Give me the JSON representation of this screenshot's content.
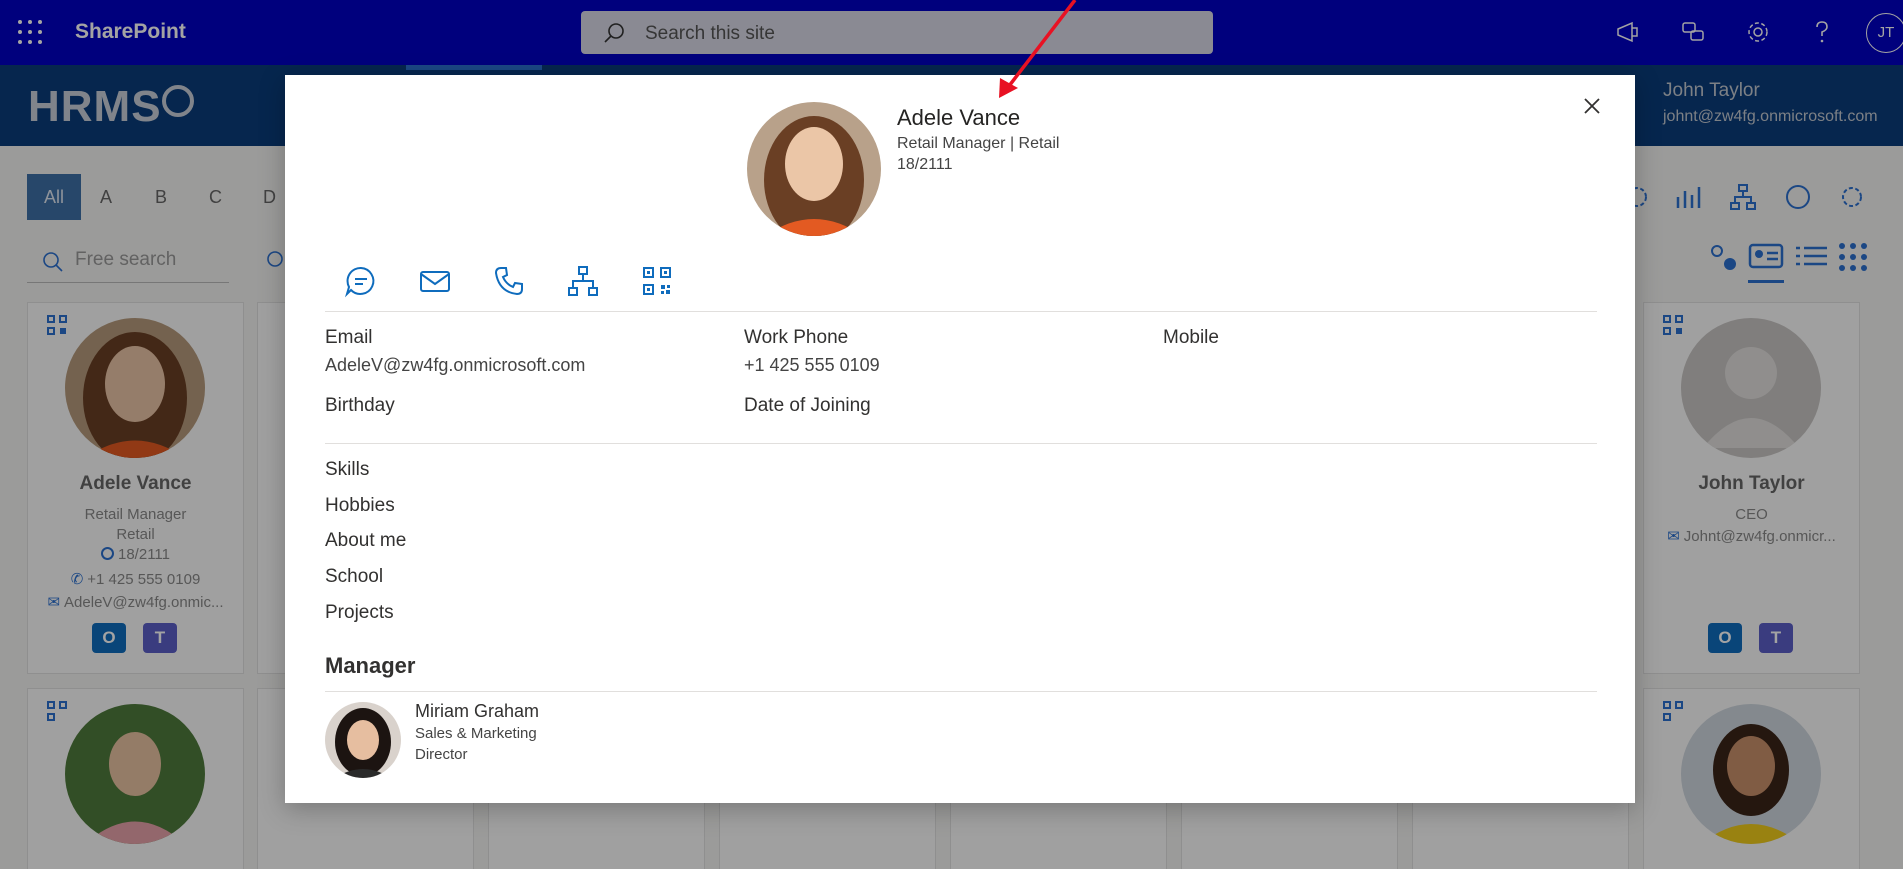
{
  "suitebar": {
    "app_title": "SharePoint",
    "search_placeholder": "Search this site",
    "avatar_initials": "JT"
  },
  "header": {
    "logo_text": "HRMS",
    "user_name": "John Taylor",
    "user_email": "johnt@zw4fg.onmicrosoft.com"
  },
  "alphabet": [
    "All",
    "A",
    "B",
    "C",
    "D"
  ],
  "free_search_placeholder": "Free search",
  "cards": [
    {
      "name": "Adele Vance",
      "title": "Retail Manager",
      "department": "Retail",
      "office": "18/2111",
      "phone": "+1 425 555 0109",
      "email": "AdeleV@zw4fg.onmic..."
    },
    {
      "name": "John Taylor",
      "title": "CEO",
      "email": "Johnt@zw4fg.onmicr..."
    }
  ],
  "modal": {
    "name": "Adele Vance",
    "role_line": "Retail Manager | Retail",
    "office": "18/2111",
    "actions": [
      "chat",
      "email",
      "call",
      "org-chart",
      "qr-code"
    ],
    "fields": {
      "email_label": "Email",
      "email_value": "AdeleV@zw4fg.onmicrosoft.com",
      "work_phone_label": "Work Phone",
      "work_phone_value": "+1 425 555 0109",
      "mobile_label": "Mobile",
      "birthday_label": "Birthday",
      "doj_label": "Date of Joining"
    },
    "sections": [
      "Skills",
      "Hobbies",
      "About me",
      "School",
      "Projects"
    ],
    "manager": {
      "heading": "Manager",
      "name": "Miriam Graham",
      "department": "Sales & Marketing",
      "job_title": "Director"
    }
  },
  "colors": {
    "suitebar": "#0000c4",
    "header": "#0a3c7a",
    "accent": "#0f6cbd",
    "arrow": "#e81123"
  }
}
